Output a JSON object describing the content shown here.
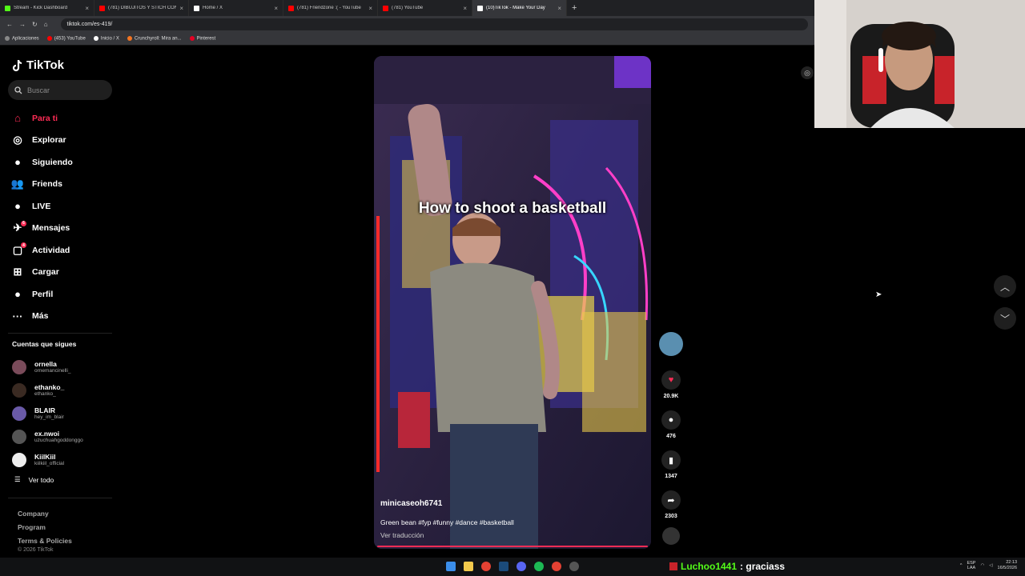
{
  "browser": {
    "tabs": [
      {
        "title": "Stream - Kick Dashboard",
        "color": "#53fc18"
      },
      {
        "title": "(781) DIBUJITOS Y STICH CONT",
        "color": "#ff0000"
      },
      {
        "title": "Home / X",
        "color": "#ffffff"
      },
      {
        "title": "(781) Friendzone :( - YouTube",
        "color": "#ff0000"
      },
      {
        "title": "(781) YouTube",
        "color": "#ff0000"
      },
      {
        "title": "(10)TikTok - Make Your Day",
        "color": "#ffffff"
      }
    ],
    "new_tab": "+",
    "url": "tiktok.com/es-419/",
    "bookmarks": [
      {
        "label": "Aplicaciones",
        "color": "#888888"
      },
      {
        "label": "(453) YouTube",
        "color": "#ff0000"
      },
      {
        "label": "Inicio / X",
        "color": "#ffffff"
      },
      {
        "label": "Crunchyroll: Mira an...",
        "color": "#f47521"
      },
      {
        "label": "Pinterest",
        "color": "#e60023"
      }
    ]
  },
  "sidebar": {
    "logo": "TikTok",
    "search_placeholder": "Buscar",
    "nav": [
      {
        "label": "Para ti",
        "icon": "home-icon",
        "glyph": "⌂"
      },
      {
        "label": "Explorar",
        "icon": "compass-icon",
        "glyph": "◎"
      },
      {
        "label": "Siguiendo",
        "icon": "following-avatar-icon",
        "glyph": "●"
      },
      {
        "label": "Friends",
        "icon": "friends-icon",
        "glyph": "👥"
      },
      {
        "label": "LIVE",
        "icon": "live-icon",
        "glyph": "●"
      },
      {
        "label": "Mensajes",
        "icon": "messages-icon",
        "glyph": "✈",
        "badge": "6"
      },
      {
        "label": "Actividad",
        "icon": "activity-icon",
        "glyph": "▢",
        "badge": "4"
      },
      {
        "label": "Cargar",
        "icon": "upload-icon",
        "glyph": "⊞"
      },
      {
        "label": "Perfil",
        "icon": "profile-icon",
        "glyph": "●"
      },
      {
        "label": "Más",
        "icon": "more-icon",
        "glyph": "···"
      }
    ],
    "following_title": "Cuentas que sigues",
    "following": [
      {
        "name": "ornella",
        "handle": "ornemancinelli_",
        "color": "#7a4b5a"
      },
      {
        "name": "ethanko_",
        "handle": "ethanko_",
        "color": "#3a2a22"
      },
      {
        "name": "BLAIR",
        "handle": "hey_im_blair",
        "color": "#6a5aa8"
      },
      {
        "name": "ex.nwoi",
        "handle": "uzuchuahgoddonggo",
        "color": "#555555"
      },
      {
        "name": "KiilKiil",
        "handle": "kiilkiil_official",
        "color": "#eeeeee"
      }
    ],
    "see_all": "Ver todo",
    "footer_links": [
      "Company",
      "Program",
      "Terms & Policies"
    ],
    "copyright": "© 2026 TikTok"
  },
  "video": {
    "caption": "How to shoot a basketball",
    "username": "minicaseoh6741",
    "description": "Green bean #fyp #funny #dance #basketball",
    "translate": "Ver traducción",
    "progress": 1.0
  },
  "actions": {
    "likes": "20.9K",
    "comments": "476",
    "saves": "1347",
    "shares": "2303"
  },
  "stream": {
    "chat_user": "Luchoo1441",
    "chat_message": ": graciass"
  },
  "tray": {
    "lang_top": "ESP",
    "lang_bottom": "LAA",
    "time": "22:13",
    "date": "16/5/2026"
  }
}
